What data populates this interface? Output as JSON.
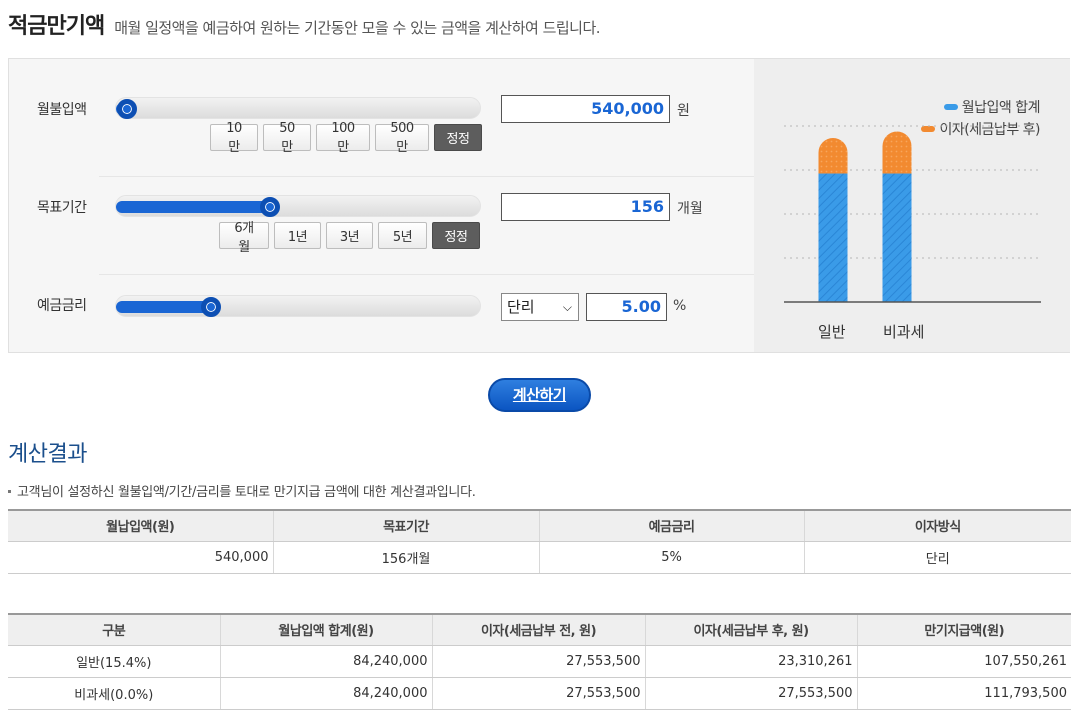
{
  "header": {
    "title": "적금만기액",
    "subtitle": "매월 일정액을 예금하여 원하는 기간동안 모을 수 있는 금액을 계산하여 드립니다."
  },
  "monthly": {
    "label": "월불입액",
    "value": "540,000",
    "unit": "원",
    "slider_fraction": 0.03,
    "buttons": [
      "10만",
      "50만",
      "100만",
      "500만",
      "정정"
    ]
  },
  "period": {
    "label": "목표기간",
    "value": "156",
    "unit": "개월",
    "slider_fraction": 0.42,
    "buttons": [
      "6개월",
      "1년",
      "3년",
      "5년",
      "정정"
    ]
  },
  "rate": {
    "label": "예금금리",
    "type_selected": "단리",
    "value": "5.00",
    "unit": "%",
    "slider_fraction": 0.26
  },
  "chart": {
    "legend": [
      {
        "label": "월납입액 합계",
        "color": "#3a9be8"
      },
      {
        "label": "이자(세금납부 후)",
        "color": "#f28a30"
      }
    ],
    "categories": [
      "일반",
      "비과세"
    ]
  },
  "chart_data": {
    "type": "bar",
    "categories": [
      "일반",
      "비과세"
    ],
    "series": [
      {
        "name": "월납입액 합계",
        "values": [
          84240000,
          84240000
        ]
      },
      {
        "name": "이자(세금납부 후)",
        "values": [
          23310261,
          27553500
        ]
      }
    ],
    "stacked": true,
    "ylim": [
      0,
      120000000
    ],
    "grid": true,
    "legend_position": "top-right"
  },
  "calc_button": "계산하기",
  "result": {
    "title": "계산결과",
    "desc": "고객님이 설정하신 월불입액/기간/금리를 토대로 만기지급 금액에 대한 계산결과입니다.",
    "summary_headers": [
      "월납입액(원)",
      "목표기간",
      "예금금리",
      "이자방식"
    ],
    "summary_row": [
      "540,000",
      "156개월",
      "5%",
      "단리"
    ],
    "detail_headers": [
      "구분",
      "월납입액 합계(원)",
      "이자(세금납부 전, 원)",
      "이자(세금납부 후, 원)",
      "만기지급액(원)"
    ],
    "detail_rows": [
      [
        "일반(15.4%)",
        "84,240,000",
        "27,553,500",
        "23,310,261",
        "107,550,261"
      ],
      [
        "비과세(0.0%)",
        "84,240,000",
        "27,553,500",
        "27,553,500",
        "111,793,500"
      ]
    ]
  }
}
